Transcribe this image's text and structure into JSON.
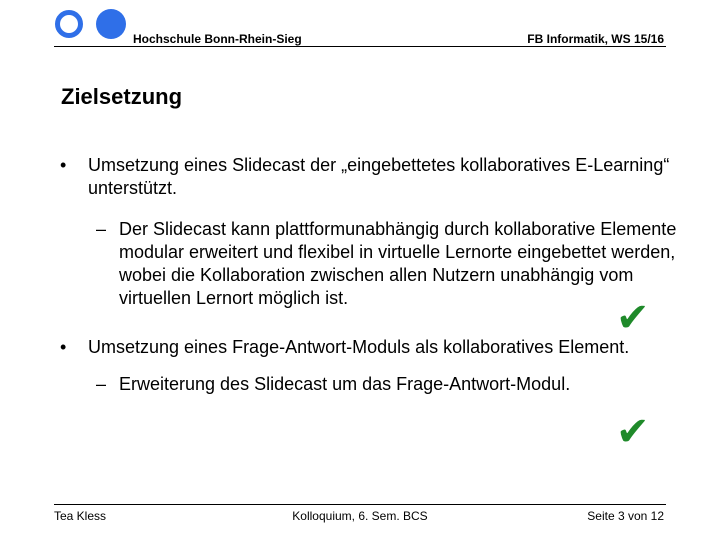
{
  "header": {
    "institution": "Hochschule Bonn-Rhein-Sieg",
    "department": "FB Informatik, WS 15/16"
  },
  "colors": {
    "logo": "#2f6fe8",
    "check": "#1f8a2a"
  },
  "slide": {
    "title": "Zielsetzung",
    "bullets": [
      {
        "marker": "•",
        "text": "Umsetzung eines Slidecast der „eingebettetes kollaboratives E-Learning“ unterstützt.",
        "sub": {
          "marker": "–",
          "text": "Der Slidecast kann plattformunabhängig durch kollaborative Elemente modular erweitert und flexibel in virtuelle Lernorte eingebettet werden, wobei die Kollaboration zwischen allen Nutzern unabhängig vom virtuellen Lernort möglich ist."
        },
        "check_icon": "✔"
      },
      {
        "marker": "•",
        "text": "Umsetzung eines Frage-Antwort-Moduls als kollaboratives Element.",
        "sub": {
          "marker": "–",
          "text": "Erweiterung des Slidecast um das Frage-Antwort-Modul."
        },
        "check_icon": "✔"
      }
    ]
  },
  "footer": {
    "author": "Tea Kless",
    "event": "Kolloquium, 6. Sem. BCS",
    "page": "Seite 3 von 12"
  }
}
